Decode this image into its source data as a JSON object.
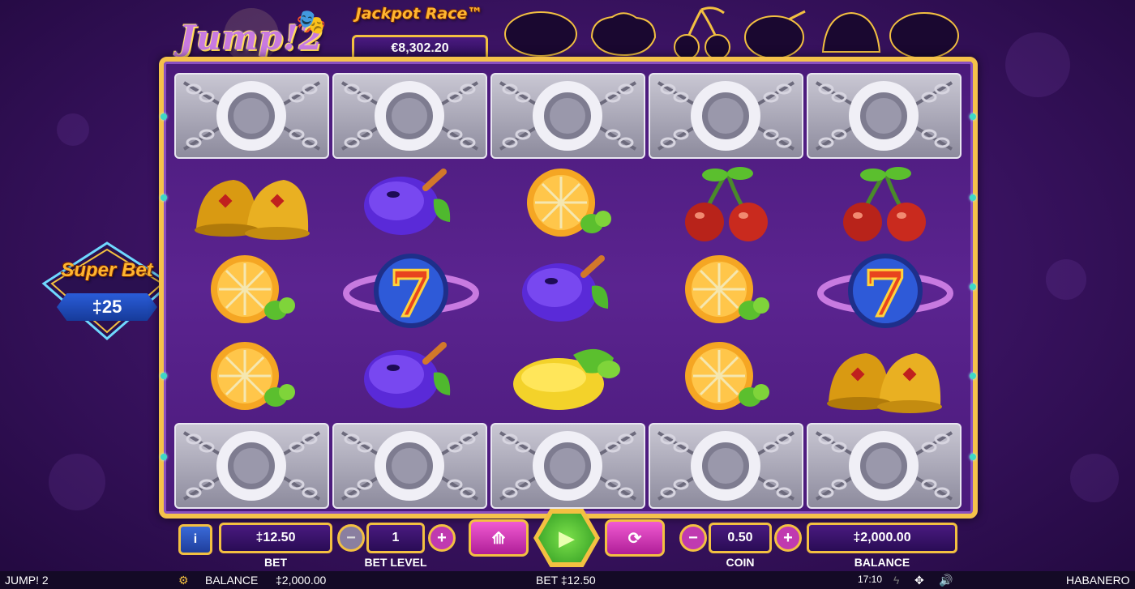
{
  "game": {
    "logo_text": "Jump!2",
    "jackpot_title": "Jackpot Race™",
    "jackpot_value": "€8,302.20"
  },
  "super_bet": {
    "title": "Super Bet",
    "value": "‡25"
  },
  "silhouettes": [
    "lemon-silhouette-icon",
    "grapes-silhouette-icon",
    "cherries-silhouette-icon",
    "plum-silhouette-icon",
    "bell-silhouette-icon",
    "lemon-silhouette-icon"
  ],
  "reels": {
    "top_row": [
      "lock",
      "lock",
      "lock",
      "lock",
      "lock"
    ],
    "bottom_row": [
      "lock",
      "lock",
      "lock",
      "lock",
      "lock"
    ],
    "grid": [
      [
        "bells",
        "plum",
        "orange",
        "cherries",
        "cherries"
      ],
      [
        "orange",
        "seven",
        "plum",
        "orange",
        "seven"
      ],
      [
        "orange",
        "plum",
        "lemon",
        "orange",
        "bells"
      ]
    ]
  },
  "controls": {
    "info_label": "i",
    "bet_value": "‡12.50",
    "bet_label": "BET",
    "bet_level_value": "1",
    "bet_level_label": "BET LEVEL",
    "coin_value": "0.50",
    "coin_label": "COIN",
    "balance_value": "‡2,000.00",
    "balance_label": "BALANCE",
    "minus": "−",
    "plus": "+"
  },
  "status_bar": {
    "game_name": "JUMP! 2",
    "balance_label": "BALANCE",
    "balance_value": "‡2,000.00",
    "bet_text": "BET ‡12.50",
    "time": "17:10",
    "provider": "HABANERO"
  },
  "colors": {
    "gold": "#f3c041",
    "background": "#3d1466",
    "accent_teal": "#3fd8c6",
    "spin_green": "#4fbf2e",
    "pink": "#d43ab8"
  }
}
